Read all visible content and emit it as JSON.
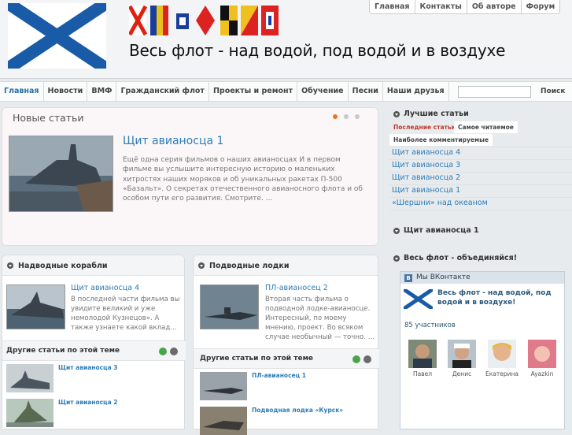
{
  "header": {
    "slogan": "Весь флот - над водой, под водой и в воздухе",
    "logo_icon": "andreevsky-flag-icon",
    "flags_icon": "signal-flags-icon"
  },
  "topnav": [
    "Главная",
    "Контакты",
    "Об авторе",
    "Форум"
  ],
  "mainnav": [
    "Главная",
    "Новости",
    "ВМФ",
    "Гражданский флот",
    "Проекты и ремонт",
    "Обучение",
    "Песни",
    "Наши друзья"
  ],
  "search": {
    "placeholder": "",
    "button": "Поиск"
  },
  "featured": {
    "title": "Новые статьи",
    "article_title": "Щит авианосца 1",
    "article_text": "Ещё одна серия фильмов о наших авианосцах И в первом фильме вы услышите интересную историю о маленьких хитростях наших моряков и об уникальных ракетах П-500 «Базальт». О секретах отечественного авианосного флота и об особом пути его развития. Смотрите. ..."
  },
  "surface": {
    "title": "Надводные корабли",
    "article_title": "Щит авианосца 4",
    "article_text": "В последней части фильма вы увидите великий и уже немолодой  Кузнецов». А также узнаете какой вклад...",
    "other_title": "Другие статьи по этой теме",
    "others": [
      "Щит авианосца 3",
      "Щит авианосца 2"
    ]
  },
  "submarines": {
    "title": "Подводные лодки",
    "article_title": "ПЛ-авианосец 2",
    "article_text": "Вторая часть фильма о подводной лодке-авианосце. Интересный, по моему мнению, проект. Во всяком случае необычный — точно. ...",
    "other_title": "Другие статьи по этой теме",
    "others": [
      "ПЛ-авианосец 1",
      "Подводная лодка «Курск»"
    ]
  },
  "right": {
    "best_title": "Лучшие статьи",
    "tabs": [
      "Последние статьи",
      "Самое читаемое",
      "Наиболее комментируемые"
    ],
    "links": [
      "Щит авианосца 4",
      "Щит авианосца 3",
      "Щит авианосца 2",
      "Щит авианосца 1",
      "«Шершни» над океаном"
    ],
    "block2_title": "Щит авианосца 1",
    "block3_title": "Весь флот - объединяйся!"
  },
  "vk": {
    "badge": "В",
    "title": "Мы ВКонтакте",
    "name": "Весь флот - над водой, под водой и в воздухе!",
    "count": "85 участников",
    "members": [
      "Павел",
      "Денис",
      "Екатерина",
      "Ayazkin"
    ]
  },
  "colors": {
    "link": "#2c7cb8",
    "active_tab": "#c0392b",
    "accent_dot": "#e8742a"
  }
}
